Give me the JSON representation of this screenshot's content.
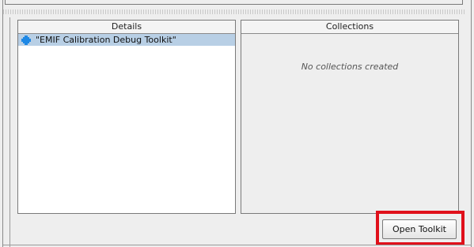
{
  "details": {
    "header": "Details",
    "items": [
      {
        "label": "\"EMIF Calibration Debug Toolkit\"",
        "icon": "toolkit-icon"
      }
    ]
  },
  "collections": {
    "header": "Collections",
    "empty_message": "No collections created"
  },
  "actions": {
    "open_toolkit_label": "Open Toolkit"
  },
  "colors": {
    "selection": "#b8cfe5",
    "highlight_border": "#e0101a",
    "icon_blue": "#1e88e5"
  }
}
